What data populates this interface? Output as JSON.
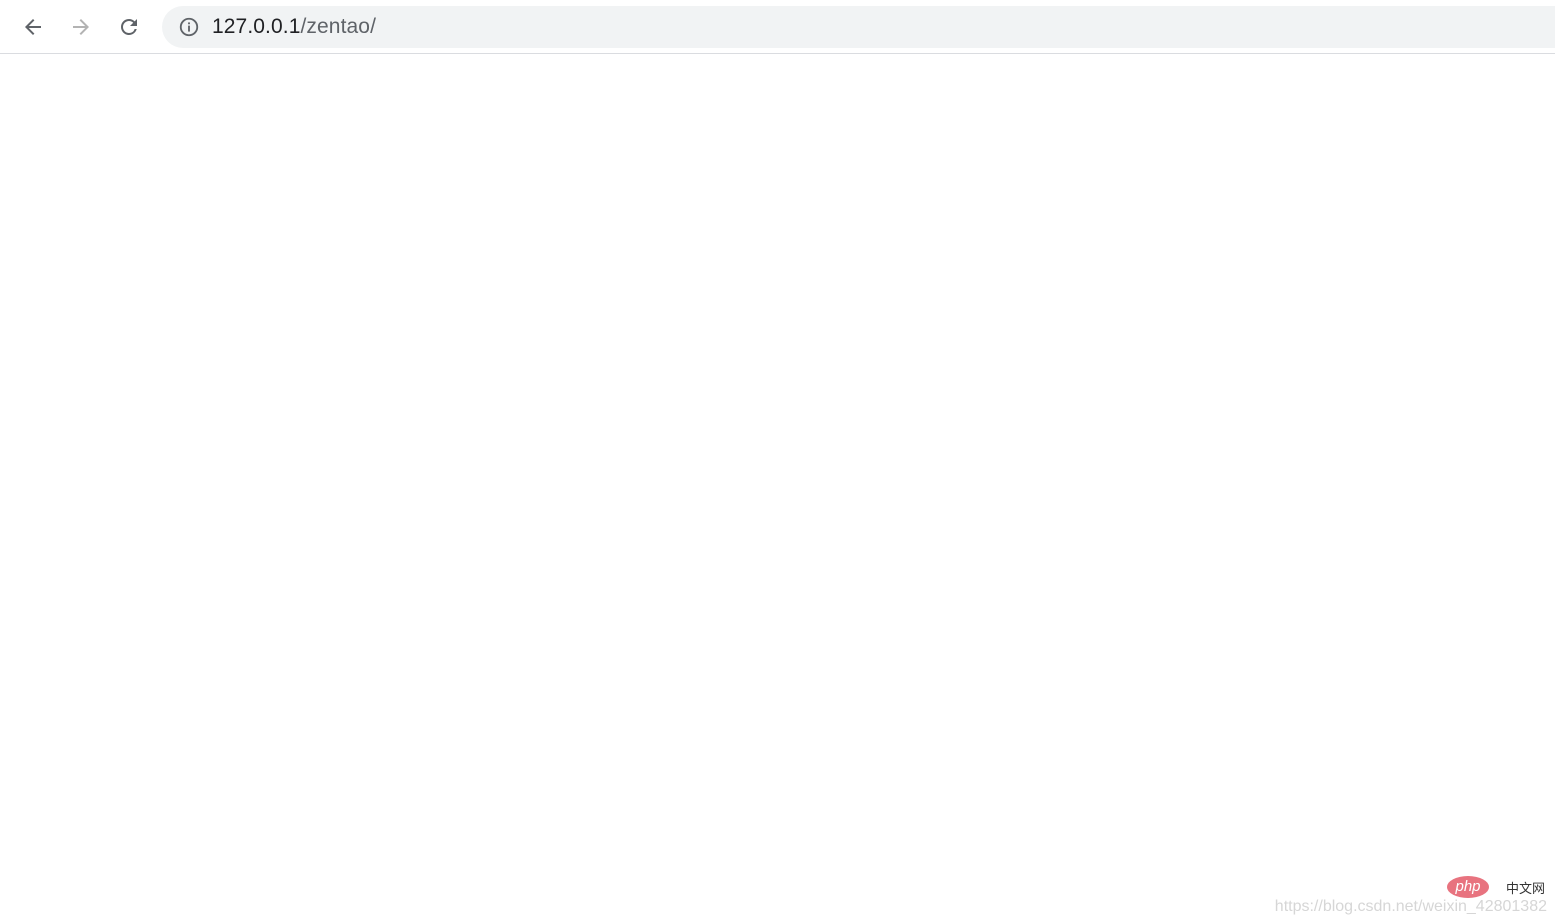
{
  "browser": {
    "url_host": "127.0.0.1",
    "url_path": "/zentao/",
    "icons": {
      "back": "arrow-left-icon",
      "forward": "arrow-right-icon",
      "reload": "reload-icon",
      "site_info": "info-circle-icon"
    },
    "colors": {
      "omnibox_bg": "#f1f3f4",
      "icon_active": "#5f6368",
      "icon_disabled": "#b3b3b3"
    }
  },
  "watermark": {
    "logo_text": "php",
    "logo_label": "中文网",
    "url": "https://blog.csdn.net/weixin_42801382"
  }
}
